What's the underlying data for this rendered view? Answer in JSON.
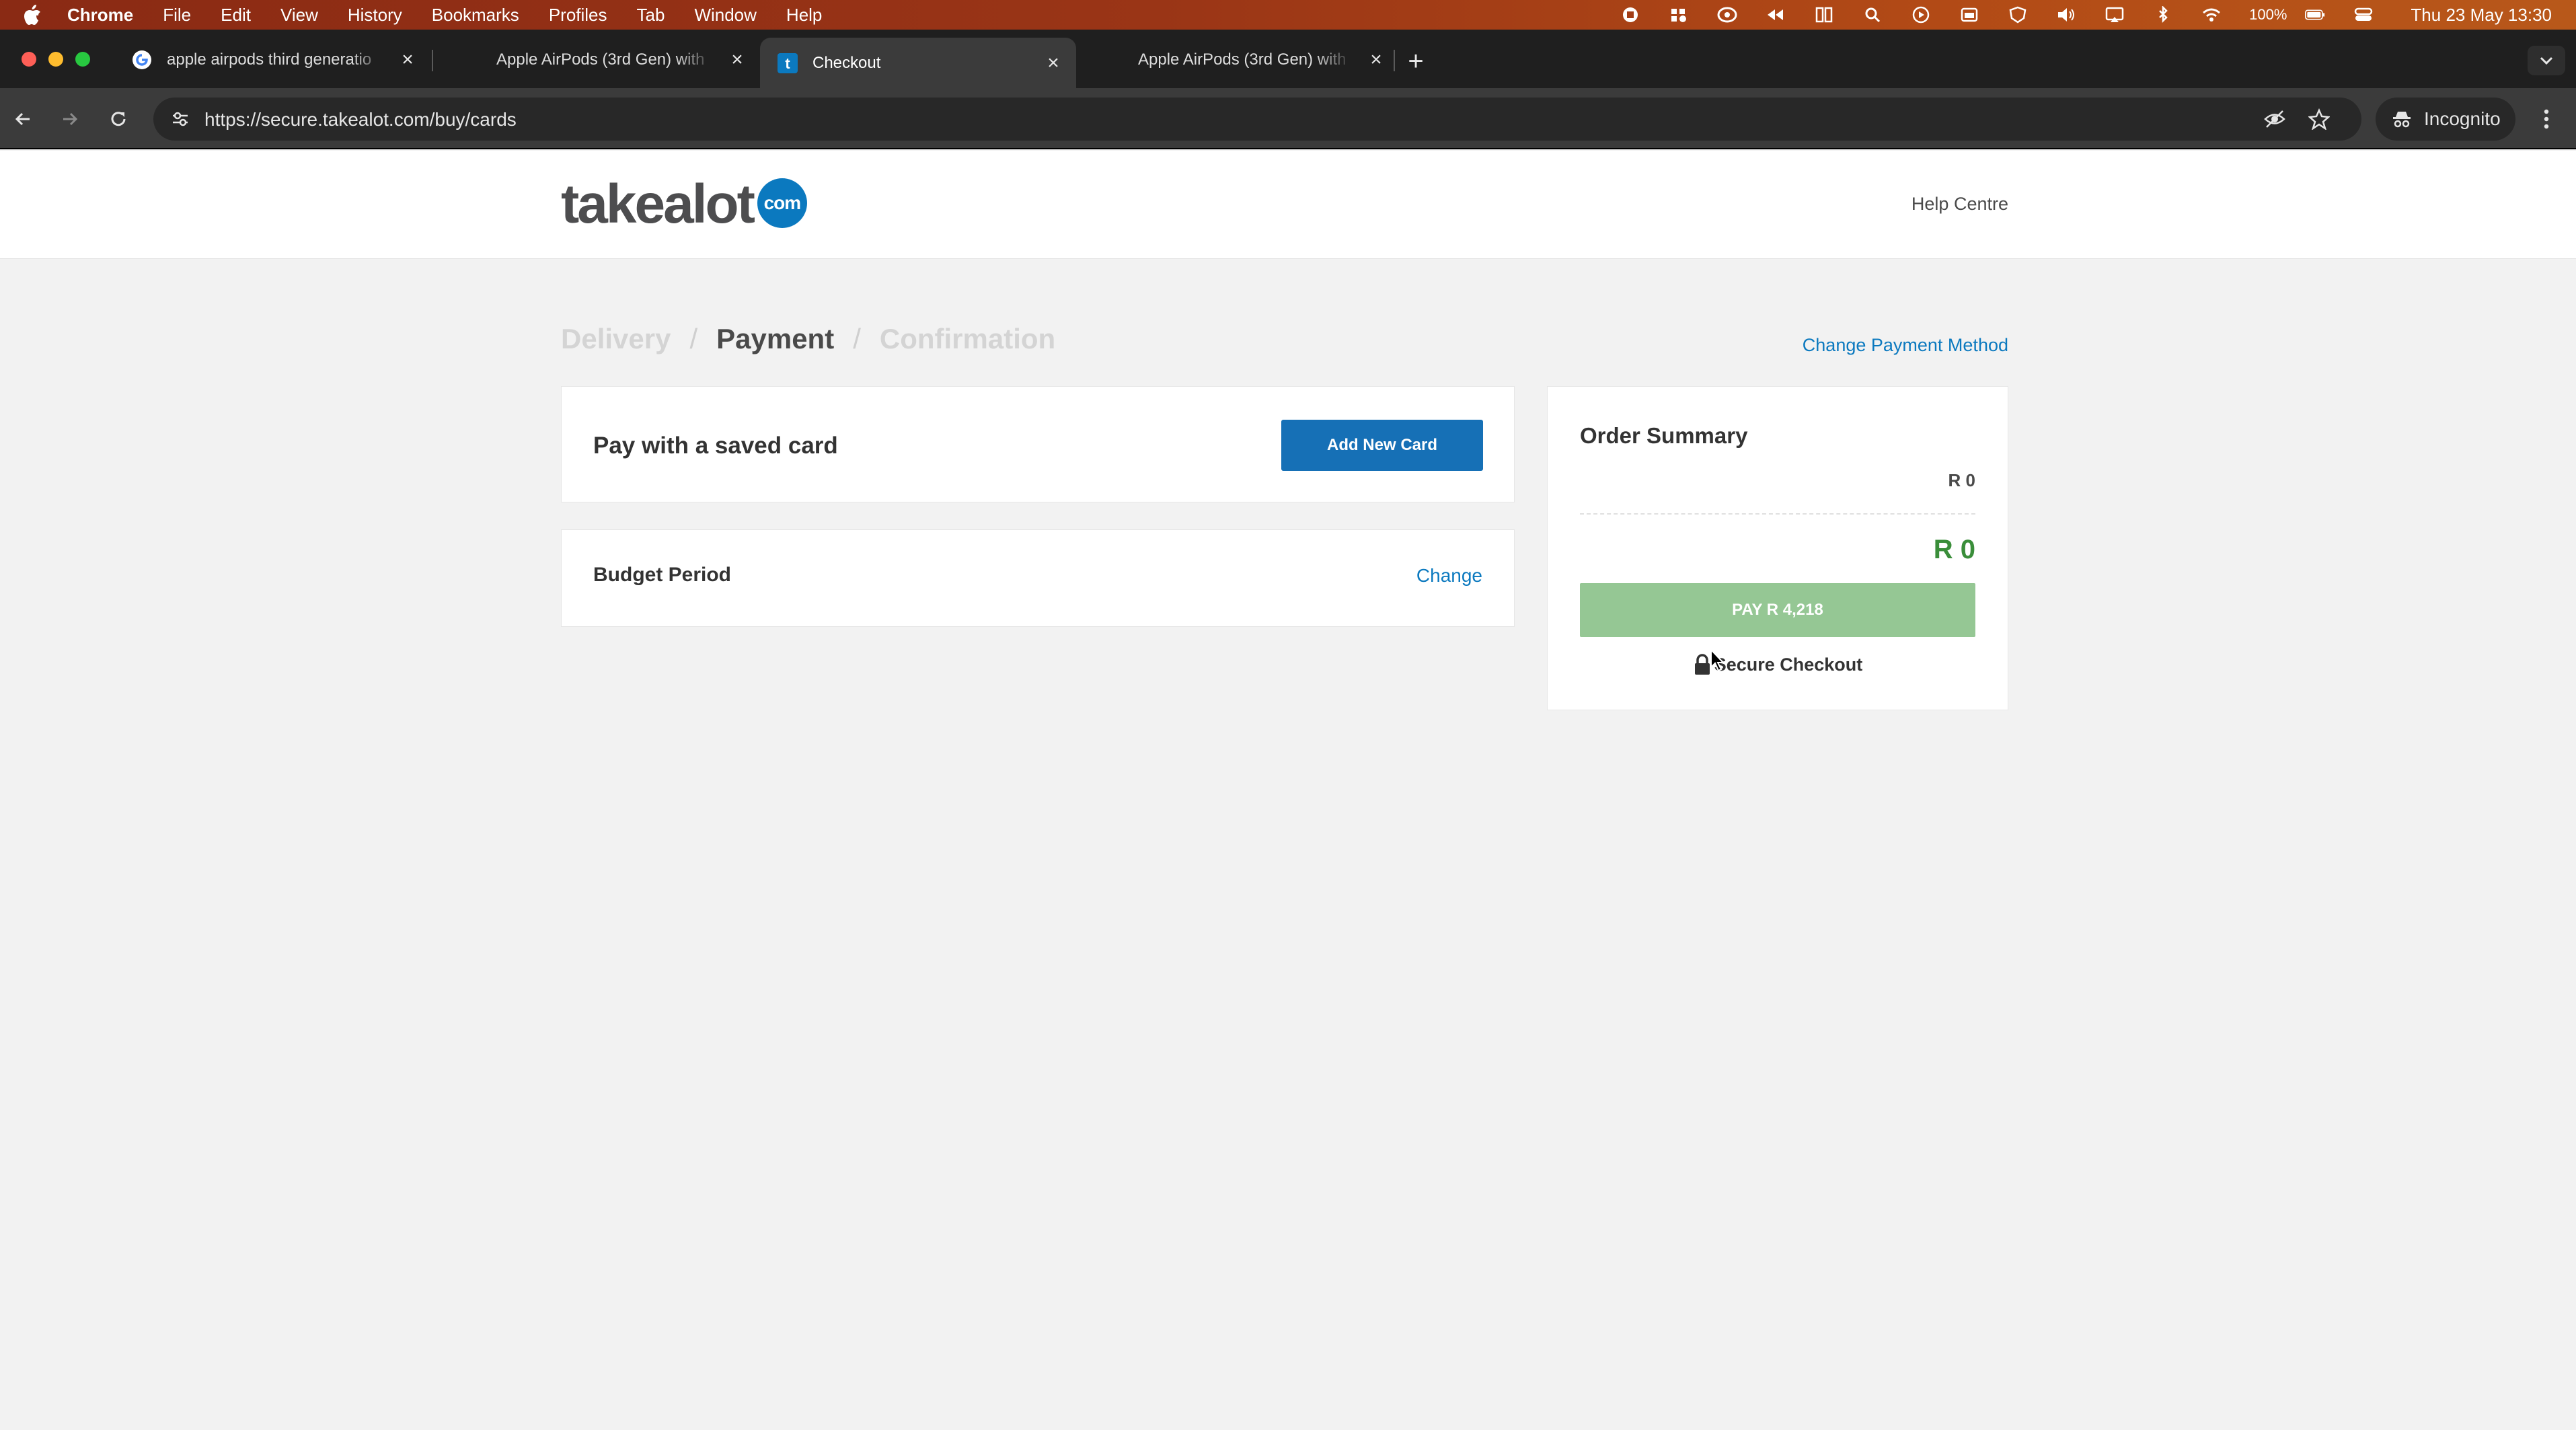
{
  "menubar": {
    "app": "Chrome",
    "items": [
      "File",
      "Edit",
      "View",
      "History",
      "Bookmarks",
      "Profiles",
      "Tab",
      "Window",
      "Help"
    ],
    "battery": "100%",
    "clock": "Thu 23 May  13:30"
  },
  "tabs": [
    {
      "title": "apple airpods third generatio",
      "favicon": "google-icon"
    },
    {
      "title": "Apple AirPods (3rd Gen) with",
      "favicon": "none"
    },
    {
      "title": "Checkout",
      "favicon": "takealot-icon",
      "active": true
    },
    {
      "title": "Apple AirPods (3rd Gen) with",
      "favicon": "none"
    }
  ],
  "toolbar": {
    "url": "https://secure.takealot.com/buy/cards",
    "profile": "Incognito"
  },
  "site": {
    "logo_word": "takealot",
    "logo_badge": "com",
    "help": "Help Centre"
  },
  "checkout": {
    "steps": [
      "Delivery",
      "Payment",
      "Confirmation"
    ],
    "current_step": "Payment",
    "change_payment": "Change Payment Method",
    "saved_card_title": "Pay with a saved card",
    "add_card": "Add New Card",
    "budget_title": "Budget Period",
    "budget_change": "Change"
  },
  "summary": {
    "title": "Order Summary",
    "subtotal": "R 0",
    "total": "R 0",
    "pay_label": "PAY R 4,218",
    "secure_label": "Secure Checkout"
  },
  "colors": {
    "accent": "#0b79bf",
    "button_blue": "#1670b6",
    "pay_disabled": "#95c794",
    "total_green": "#3a8e3a"
  }
}
